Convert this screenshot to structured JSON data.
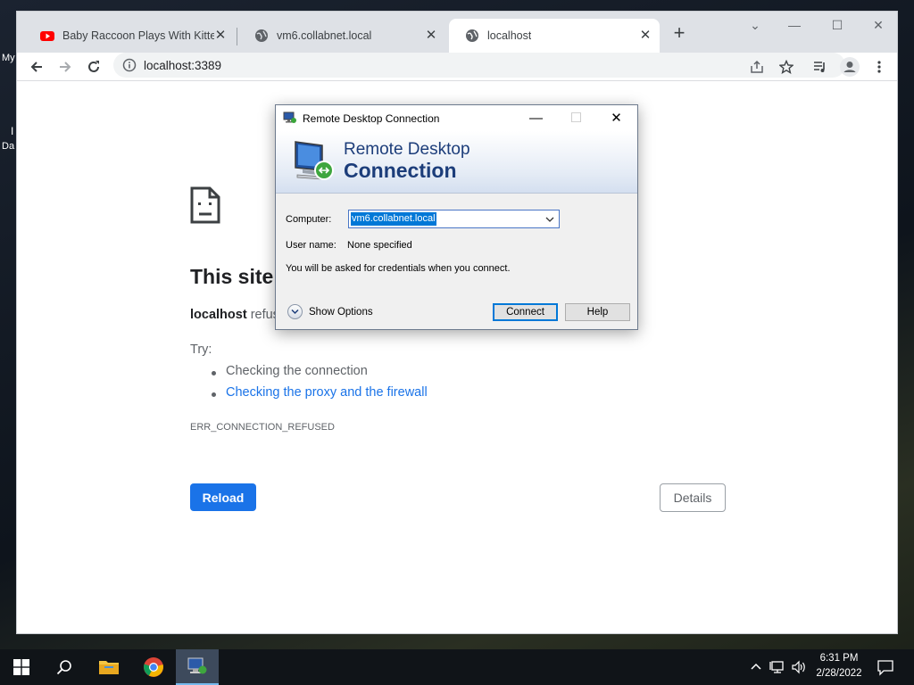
{
  "desktop": {
    "icon_label_1": "My",
    "icon_label_2": "Da",
    "icon_label_3": "I"
  },
  "browser": {
    "tabs": [
      {
        "title": "Baby Raccoon Plays With Kitten",
        "favicon": "youtube-icon",
        "active": false
      },
      {
        "title": "vm6.collabnet.local",
        "favicon": "globe-icon",
        "active": false
      },
      {
        "title": "localhost",
        "favicon": "globe-icon",
        "active": true
      }
    ],
    "address": "localhost:3389"
  },
  "error_page": {
    "title": "This site",
    "host": "localhost",
    "host_suffix": "refus",
    "try_label": "Try:",
    "suggestions": [
      {
        "text": "Checking the connection",
        "link": false
      },
      {
        "text": "Checking the proxy and the firewall",
        "link": true
      }
    ],
    "error_code": "ERR_CONNECTION_REFUSED",
    "reload_label": "Reload",
    "details_label": "Details"
  },
  "rdc_dialog": {
    "title": "Remote Desktop Connection",
    "banner_line1": "Remote Desktop",
    "banner_line2": "Connection",
    "computer_label": "Computer:",
    "computer_value": "vm6.collabnet.local",
    "username_label": "User name:",
    "username_value": "None specified",
    "credentials_note": "You will be asked for credentials when you connect.",
    "show_options_label": "Show Options",
    "connect_label": "Connect",
    "help_label": "Help"
  },
  "taskbar": {
    "apps": [
      "start-icon",
      "search-icon",
      "file-explorer-icon",
      "chrome-icon",
      "remote-desktop-icon"
    ],
    "time": "6:31 PM",
    "date": "2/28/2022"
  }
}
